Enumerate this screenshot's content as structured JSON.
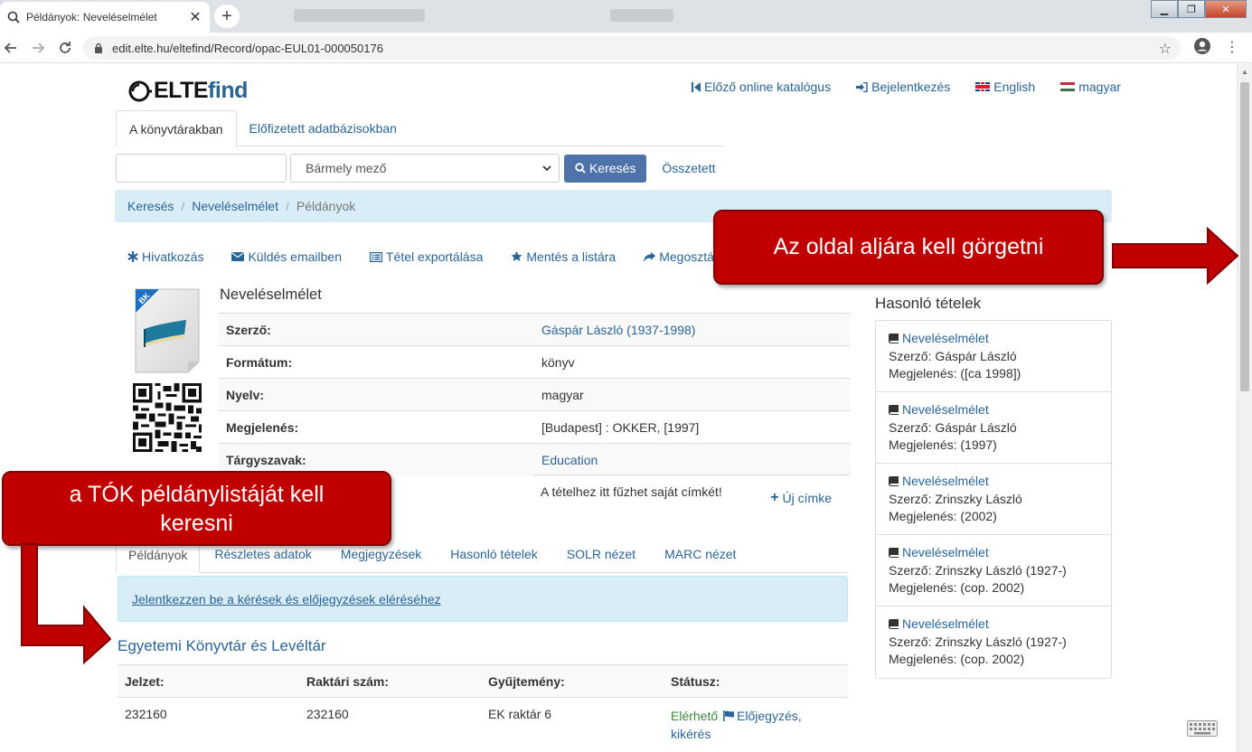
{
  "browser": {
    "tab_title": "Példányok: Neveléselmélet",
    "tab_close": "✕",
    "new_tab": "+",
    "url": "edit.elte.hu/eltefind/Record/opac-EUL01-000050176",
    "win_min": "▁",
    "win_max": "❐",
    "win_close": "✕"
  },
  "header": {
    "logo_elte": "ELTE",
    "logo_find": "find",
    "links": [
      {
        "label": "Előző online katalógus"
      },
      {
        "label": "Bejelentkezés"
      },
      {
        "label": "English"
      },
      {
        "label": "magyar"
      }
    ]
  },
  "search": {
    "tabs": [
      "A könyvtárakban",
      "Előfizetett adatbázisokban"
    ],
    "input_value": "",
    "select_value": "Bármely mező",
    "button_label": "Keresés",
    "advanced_label": "Összetett"
  },
  "breadcrumb": [
    "Keresés",
    "Neveléselmélet",
    "Példányok"
  ],
  "toolbar": [
    "Hivatkozás",
    "Küldés emailben",
    "Tétel exportálása",
    "Mentés a listára",
    "Megosztás"
  ],
  "record": {
    "cover_badge": "BK",
    "title": "Neveléselmélet",
    "fields": [
      {
        "label": "Szerző:",
        "value": "Gáspár László (1937-1998)"
      },
      {
        "label": "Formátum:",
        "value": "könyv"
      },
      {
        "label": "Nyelv:",
        "value": "magyar"
      },
      {
        "label": "Megjelenés:",
        "value": "[Budapest] : OKKER, [1997]"
      },
      {
        "label": "Tárgyszavak:",
        "value": "Education"
      }
    ],
    "tags_text": "A tételhez itt fűzhet saját címkét!",
    "new_tag": "Új címke"
  },
  "holdings_tabs": [
    "Példányok",
    "Részletes adatok",
    "Megjegyzések",
    "Hasonló tételek",
    "SOLR nézet",
    "MARC nézet"
  ],
  "login_alert": "Jelentkezzen be a kérések és előjegyzések eléréséhez",
  "library": {
    "name": "Egyetemi Könyvtár és Levéltár",
    "columns": [
      "Jelzet:",
      "Raktári szám:",
      "Gyűjtemény:",
      "Státusz:"
    ],
    "rows": [
      {
        "jelzet": "232160",
        "raktari": "232160",
        "gyujtemeny": "EK raktár 6",
        "status": "Elérhető",
        "action": "Előjegyzés,",
        "action2": "kikérés"
      }
    ]
  },
  "similar": {
    "title": "Hasonló tételek",
    "items": [
      {
        "title": "Neveléselmélet",
        "author": "Szerző: Gáspár László",
        "pub": "Megjelenés: ([ca 1998])"
      },
      {
        "title": "Neveléselmélet",
        "author": "Szerző: Gáspár László",
        "pub": "Megjelenés: (1997)"
      },
      {
        "title": "Neveléselmélet",
        "author": "Szerző: Zrinszky László",
        "pub": "Megjelenés: (2002)"
      },
      {
        "title": "Neveléselmélet",
        "author": "Szerző: Zrinszky László (1927-)",
        "pub": "Megjelenés: (cop. 2002)"
      },
      {
        "title": "Neveléselmélet",
        "author": "Szerző: Zrinszky László (1927-)",
        "pub": "Megjelenés: (cop. 2002)"
      }
    ]
  },
  "annotations": {
    "scroll_hint": "Az oldal aljára kell görgetni",
    "list_hint": "a TÓK példánylistáját kell keresni"
  },
  "colors": {
    "link": "#2a6496",
    "callout": "#c00000",
    "breadcrumb_bg": "#d9edf7",
    "search_button": "#4e73a8",
    "available": "#3c8a3c"
  }
}
